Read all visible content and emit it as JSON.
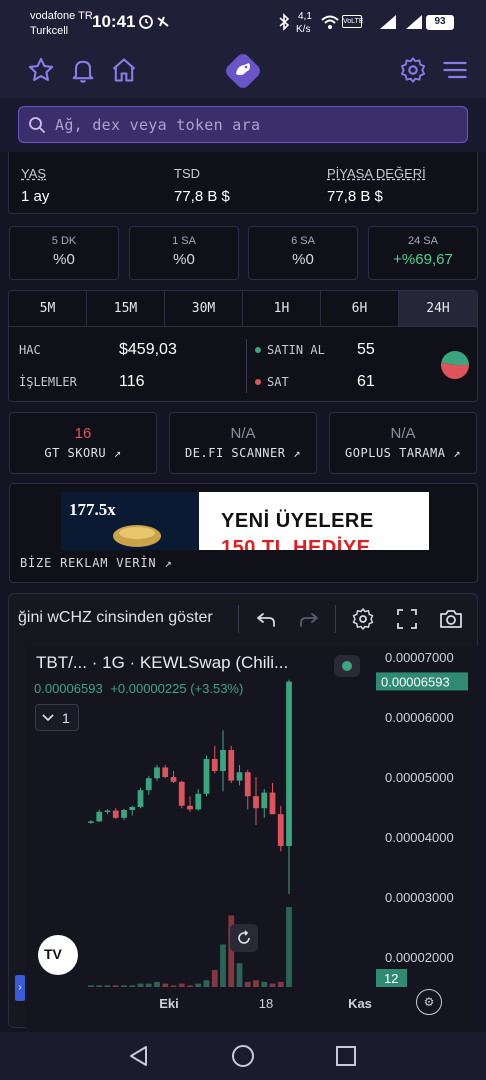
{
  "status_bar": {
    "carrier_line1": "vodafone TR",
    "carrier_line2": "Turkcell",
    "time": "10:41",
    "net_speed_value": "4,1",
    "net_speed_unit": "K/s",
    "battery": "93"
  },
  "search": {
    "placeholder": "Ağ, dex veya token ara"
  },
  "info_row": {
    "age_label": "YAŞ",
    "age_value": "1 ay",
    "tsd_label": "TSD",
    "tsd_value": "77,8 B $",
    "mcap_label": "PİYASA DEĞERİ",
    "mcap_value": "77,8 B $"
  },
  "price_changes": [
    {
      "period": "5 DK",
      "value": "%0"
    },
    {
      "period": "1 SA",
      "value": "%0"
    },
    {
      "period": "6 SA",
      "value": "%0"
    },
    {
      "period": "24 SA",
      "value": "+%69,67"
    }
  ],
  "timeframes": [
    "5M",
    "15M",
    "30M",
    "1H",
    "6H",
    "24H"
  ],
  "stats": {
    "volume_label": "HAC",
    "volume_value": "$459,03",
    "tx_label": "İŞLEMLER",
    "tx_value": "116",
    "buy_label": "SATIN AL",
    "buy_value": "55",
    "sell_label": "SAT",
    "sell_value": "61"
  },
  "cards": {
    "gt_score_value": "16",
    "gt_score_label": "GT SKORU",
    "defi_value": "N/A",
    "defi_label": "DE.FI SCANNER",
    "goplus_value": "N/A",
    "goplus_label": "GOPLUS TARAMA"
  },
  "ad": {
    "multiplier": "177.5x",
    "banner_text": "YENİ ÜYELERE",
    "banner_subtext": "150 TL HEDİYE",
    "advertise_label": "BİZE REKLAM VERİN"
  },
  "chart_toolbar": {
    "currency_toggle": "ğini wCHZ cinsinden göster"
  },
  "chart_header": {
    "symbol": "TBT/...",
    "interval_exchange": "· 1G · KEWLSwap (Chili...",
    "price": "0.00006593",
    "change": "+0.00000225 (+3.53%)",
    "indicator_count": "1",
    "logo_text": "TV"
  },
  "chart_data": {
    "type": "candlestick",
    "x_tick_labels": [
      "Eki",
      "18",
      "Kas"
    ],
    "y_tick_labels": [
      "0.00007000",
      "0.00006000",
      "0.00005000",
      "0.00004000",
      "0.00003000",
      "0.00002000"
    ],
    "ylim": [
      1.5e-05,
      7.2e-05
    ],
    "last_price_label": "0.00006593",
    "volume_label": "12",
    "colors": {
      "up": "#3aa57f",
      "down": "#e0535a"
    },
    "candles": [
      {
        "o": 4.25e-05,
        "h": 4.28e-05,
        "l": 4.22e-05,
        "c": 4.26e-05,
        "v": 1
      },
      {
        "o": 4.26e-05,
        "h": 4.46e-05,
        "l": 4.25e-05,
        "c": 4.42e-05,
        "v": 1
      },
      {
        "o": 4.42e-05,
        "h": 4.46e-05,
        "l": 4.38e-05,
        "c": 4.44e-05,
        "v": 1
      },
      {
        "o": 4.44e-05,
        "h": 4.48e-05,
        "l": 4.3e-05,
        "c": 4.32e-05,
        "v": 1
      },
      {
        "o": 4.32e-05,
        "h": 4.47e-05,
        "l": 4.28e-05,
        "c": 4.45e-05,
        "v": 1
      },
      {
        "o": 4.45e-05,
        "h": 4.52e-05,
        "l": 4.36e-05,
        "c": 4.5e-05,
        "v": 1
      },
      {
        "o": 4.5e-05,
        "h": 4.82e-05,
        "l": 4.48e-05,
        "c": 4.78e-05,
        "v": 2
      },
      {
        "o": 4.78e-05,
        "h": 5.02e-05,
        "l": 4.7e-05,
        "c": 4.98e-05,
        "v": 2
      },
      {
        "o": 4.98e-05,
        "h": 5.2e-05,
        "l": 4.94e-05,
        "c": 5.16e-05,
        "v": 3
      },
      {
        "o": 5.16e-05,
        "h": 5.2e-05,
        "l": 4.98e-05,
        "c": 5e-05,
        "v": 2
      },
      {
        "o": 5e-05,
        "h": 5.1e-05,
        "l": 4.9e-05,
        "c": 4.92e-05,
        "v": 1
      },
      {
        "o": 4.92e-05,
        "h": 4.94e-05,
        "l": 4.48e-05,
        "c": 4.52e-05,
        "v": 2
      },
      {
        "o": 4.52e-05,
        "h": 4.68e-05,
        "l": 4.42e-05,
        "c": 4.46e-05,
        "v": 1
      },
      {
        "o": 4.46e-05,
        "h": 4.8e-05,
        "l": 4.44e-05,
        "c": 4.72e-05,
        "v": 2
      },
      {
        "o": 4.72e-05,
        "h": 5.36e-05,
        "l": 4.68e-05,
        "c": 5.3e-05,
        "v": 4
      },
      {
        "o": 5.3e-05,
        "h": 5.52e-05,
        "l": 5.06e-05,
        "c": 5.1e-05,
        "v": 10
      },
      {
        "o": 5.1e-05,
        "h": 5.78e-05,
        "l": 4.76e-05,
        "c": 5.45e-05,
        "v": 25
      },
      {
        "o": 5.45e-05,
        "h": 5.52e-05,
        "l": 4.9e-05,
        "c": 4.94e-05,
        "v": 42
      },
      {
        "o": 4.94e-05,
        "h": 5.2e-05,
        "l": 4.86e-05,
        "c": 5.08e-05,
        "v": 14
      },
      {
        "o": 5.08e-05,
        "h": 5.12e-05,
        "l": 4.46e-05,
        "c": 4.68e-05,
        "v": 3
      },
      {
        "o": 4.68e-05,
        "h": 5e-05,
        "l": 4.2e-05,
        "c": 4.48e-05,
        "v": 4
      },
      {
        "o": 4.48e-05,
        "h": 4.8e-05,
        "l": 4.32e-05,
        "c": 4.74e-05,
        "v": 3
      },
      {
        "o": 4.74e-05,
        "h": 4.9e-05,
        "l": 4.4e-05,
        "c": 4.38e-05,
        "v": 2
      },
      {
        "o": 4.38e-05,
        "h": 4.52e-05,
        "l": 3.76e-05,
        "c": 3.85e-05,
        "v": 3
      },
      {
        "o": 3.85e-05,
        "h": 6.62e-05,
        "l": 3.05e-05,
        "c": 6.59e-05,
        "v": 47
      }
    ]
  },
  "colors": {
    "accent": "#6a55c8",
    "up": "#3aa57f",
    "down": "#e0535a",
    "panel_bg": "#101018",
    "page_bg": "#141422"
  }
}
